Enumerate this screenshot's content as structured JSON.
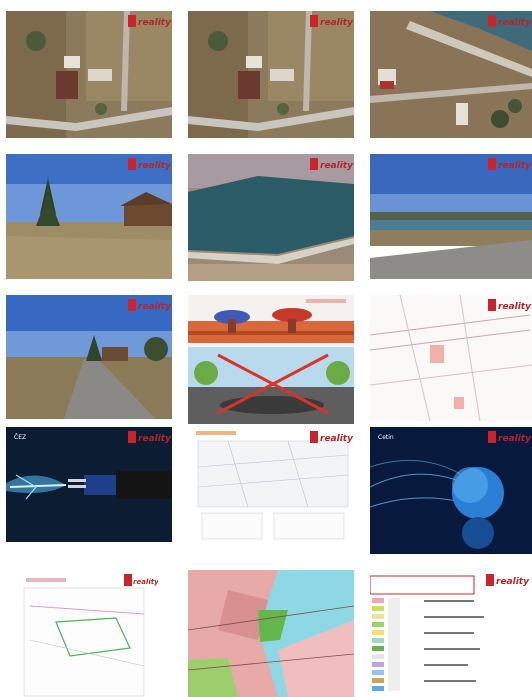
{
  "gallery": {
    "watermark": "reality",
    "thumbnails": [
      {
        "kind": "aerial-plot"
      },
      {
        "kind": "aerial-plot"
      },
      {
        "kind": "aerial-lake-shore"
      },
      {
        "kind": "field-house"
      },
      {
        "kind": "aerial-lake"
      },
      {
        "kind": "lake-field"
      },
      {
        "kind": "road-village"
      },
      {
        "kind": "utility-connection-illustration"
      },
      {
        "kind": "cadastral-map"
      },
      {
        "kind": "electricity-cable",
        "caption": "ČEZ"
      },
      {
        "kind": "document-scan"
      },
      {
        "kind": "internet-globe",
        "caption": "Cetin"
      },
      {
        "kind": "geometric-plan"
      },
      {
        "kind": "zoning-map"
      },
      {
        "kind": "map-legend"
      }
    ]
  }
}
